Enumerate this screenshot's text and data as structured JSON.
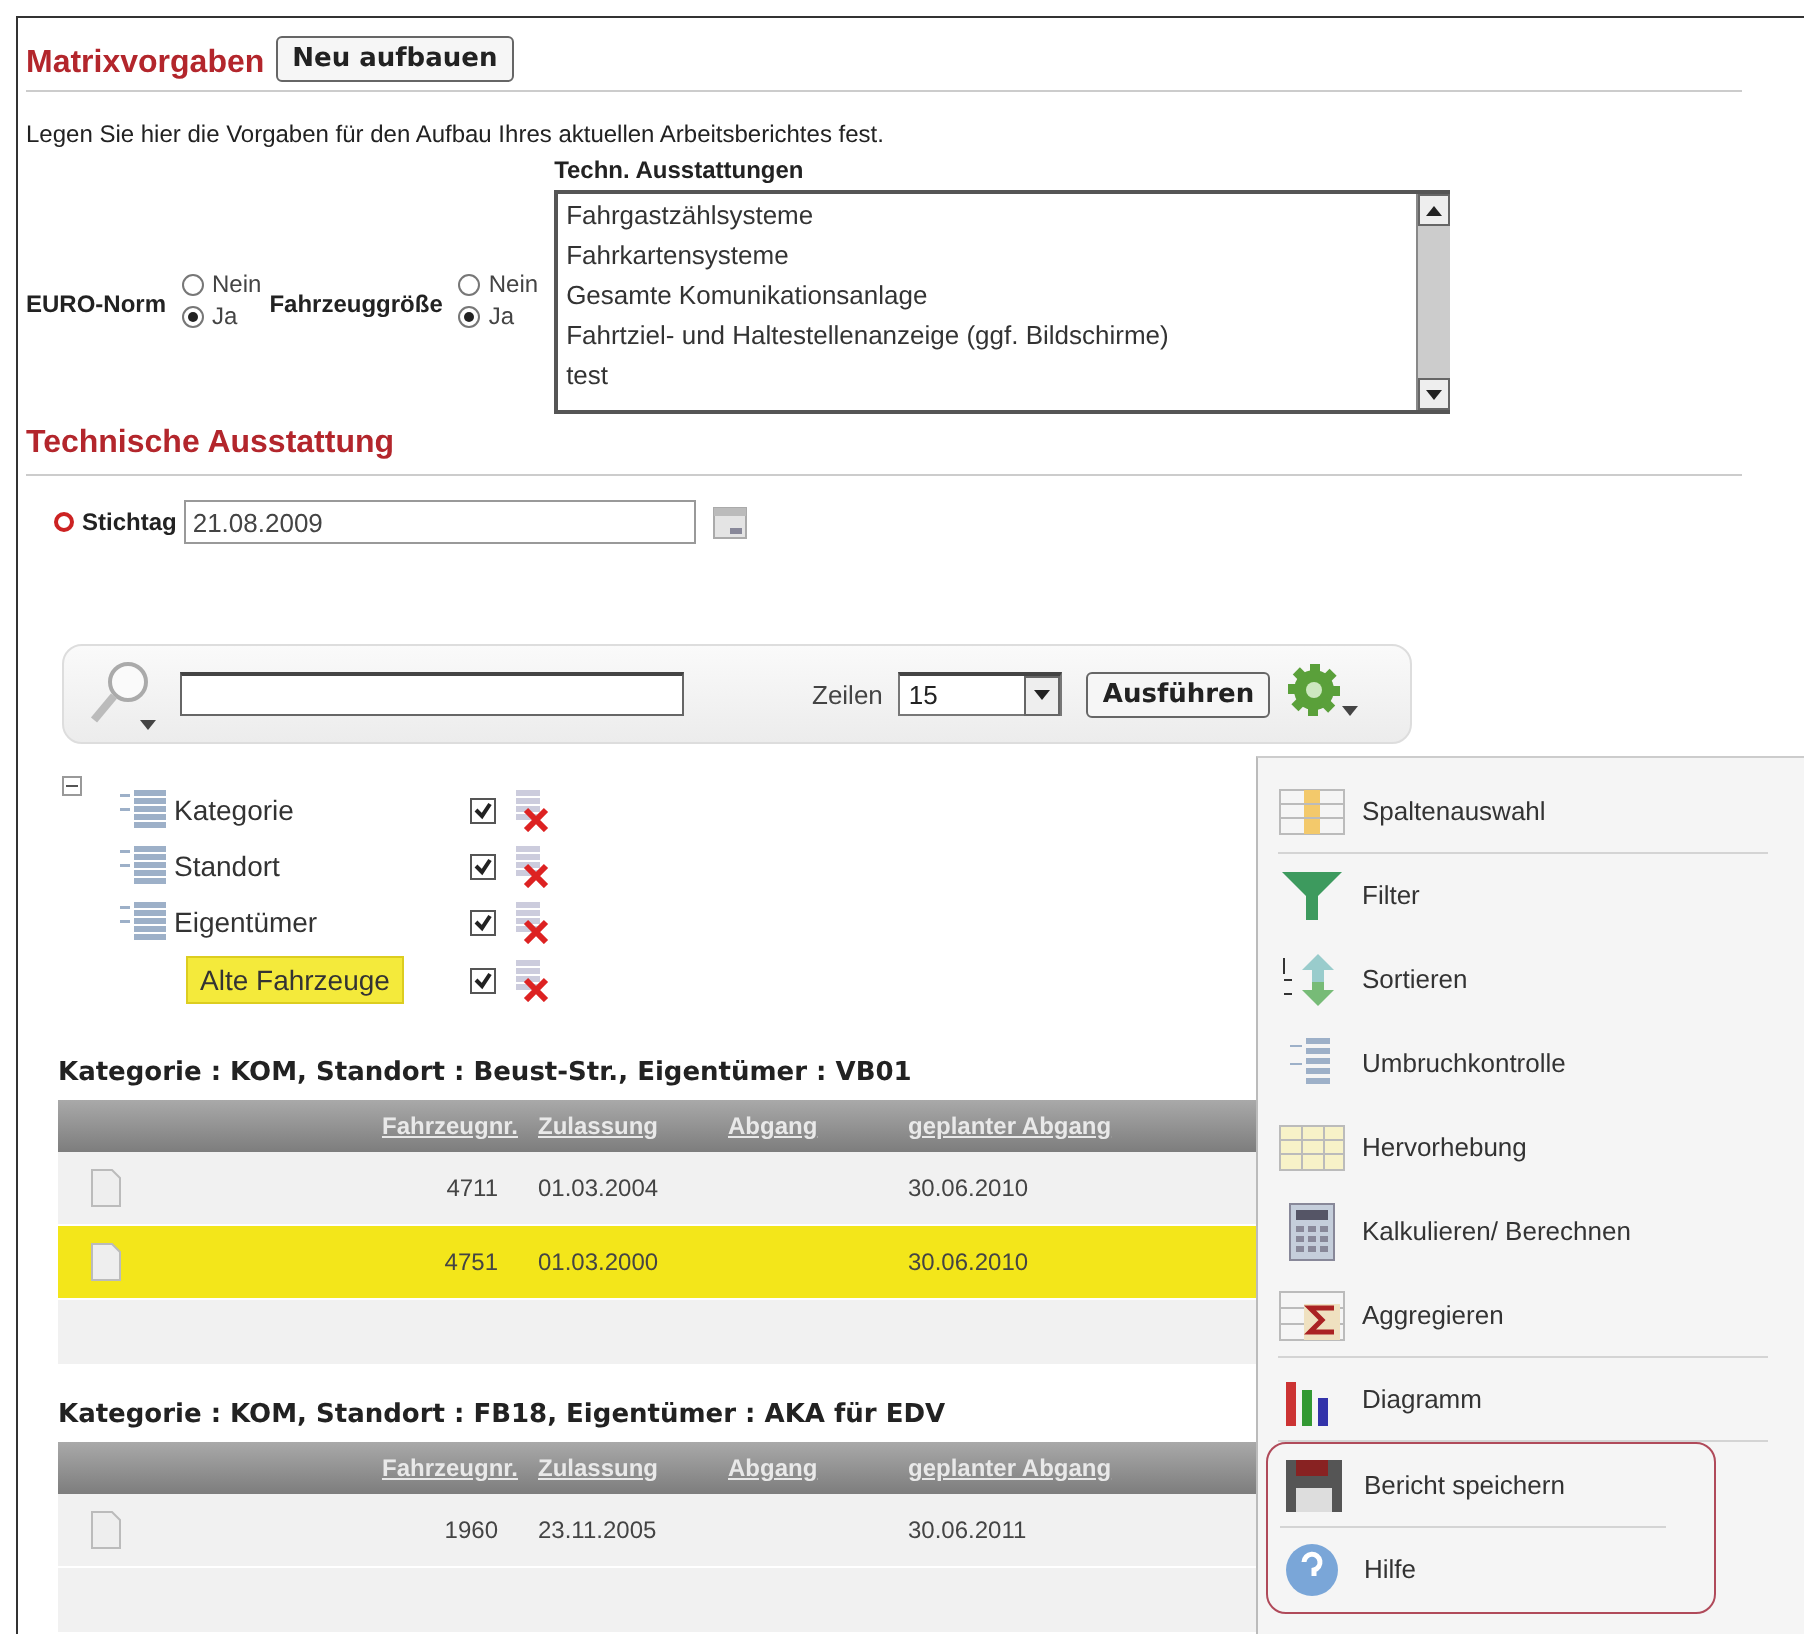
{
  "matrix": {
    "title": "Matrixvorgaben",
    "rebuild_button": "Neu aufbauen",
    "description": "Legen Sie hier die Vorgaben für den Aufbau Ihres aktuellen Arbeitsberichtes fest.",
    "radio_groups": [
      {
        "label": "EURO-Norm",
        "options": [
          {
            "label": "Nein",
            "selected": false
          },
          {
            "label": "Ja",
            "selected": true
          }
        ]
      },
      {
        "label": "Fahrzeuggröße",
        "options": [
          {
            "label": "Nein",
            "selected": false
          },
          {
            "label": "Ja",
            "selected": true
          }
        ]
      }
    ],
    "equipment_list": {
      "label": "Techn. Ausstattungen",
      "items": [
        "Fahrgastzählsysteme",
        "Fahrkartensysteme",
        "Gesamte Komunikationsanlage",
        "Fahrtziel- und Haltestellenanzeige (ggf. Bildschirme)",
        "test"
      ]
    }
  },
  "technical": {
    "title": "Technische Ausstattung",
    "date_label": "Stichtag",
    "required": true,
    "date_value": "21.08.2009"
  },
  "toolbar": {
    "rows_label": "Zeilen",
    "rows_value": "15",
    "run_button": "Ausführen"
  },
  "tree": {
    "expanded": true,
    "children": [
      {
        "label": "Kategorie",
        "checked": true,
        "highlighted": false
      },
      {
        "label": "Standort",
        "checked": true,
        "highlighted": false
      },
      {
        "label": "Eigentümer",
        "checked": true,
        "highlighted": false
      },
      {
        "label": "Alte Fahrzeuge",
        "checked": true,
        "highlighted": true
      }
    ]
  },
  "groups": [
    {
      "heading": "Kategorie : KOM, Standort : Beust-Str., Eigentümer : VB01",
      "columns": [
        "Fahrzeugnr.",
        "Zulassung",
        "Abgang",
        "geplanter Abgang"
      ],
      "rows": [
        {
          "cells": [
            "4711",
            "01.03.2004",
            "",
            "30.06.2010"
          ],
          "selected": false
        },
        {
          "cells": [
            "4751",
            "01.03.2000",
            "",
            "30.06.2010"
          ],
          "selected": true
        }
      ]
    },
    {
      "heading": "Kategorie : KOM, Standort : FB18, Eigentümer : AKA für EDV",
      "columns": [
        "Fahrzeugnr.",
        "Zulassung",
        "Abgang",
        "geplanter Abgang"
      ],
      "rows": [
        {
          "cells": [
            "1960",
            "23.11.2005",
            "",
            "30.06.2011"
          ],
          "selected": false
        }
      ]
    }
  ],
  "menu": {
    "open": true,
    "items": [
      {
        "label": "Spaltenauswahl",
        "separator_below": true,
        "outlined": false
      },
      {
        "label": "Filter",
        "separator_below": false,
        "outlined": false
      },
      {
        "label": "Sortieren",
        "separator_below": false,
        "outlined": false
      },
      {
        "label": "Umbruchkontrolle",
        "separator_below": false,
        "outlined": false
      },
      {
        "label": "Hervorhebung",
        "separator_below": false,
        "outlined": false
      },
      {
        "label": "Kalkulieren/ Berechnen",
        "separator_below": false,
        "outlined": false
      },
      {
        "label": "Aggregieren",
        "separator_below": true,
        "outlined": false
      },
      {
        "label": "Diagramm",
        "separator_below": true,
        "outlined": false
      },
      {
        "label": "Bericht speichern",
        "separator_below": true,
        "outlined": true
      },
      {
        "label": "Hilfe",
        "separator_below": false,
        "outlined": true
      }
    ]
  }
}
